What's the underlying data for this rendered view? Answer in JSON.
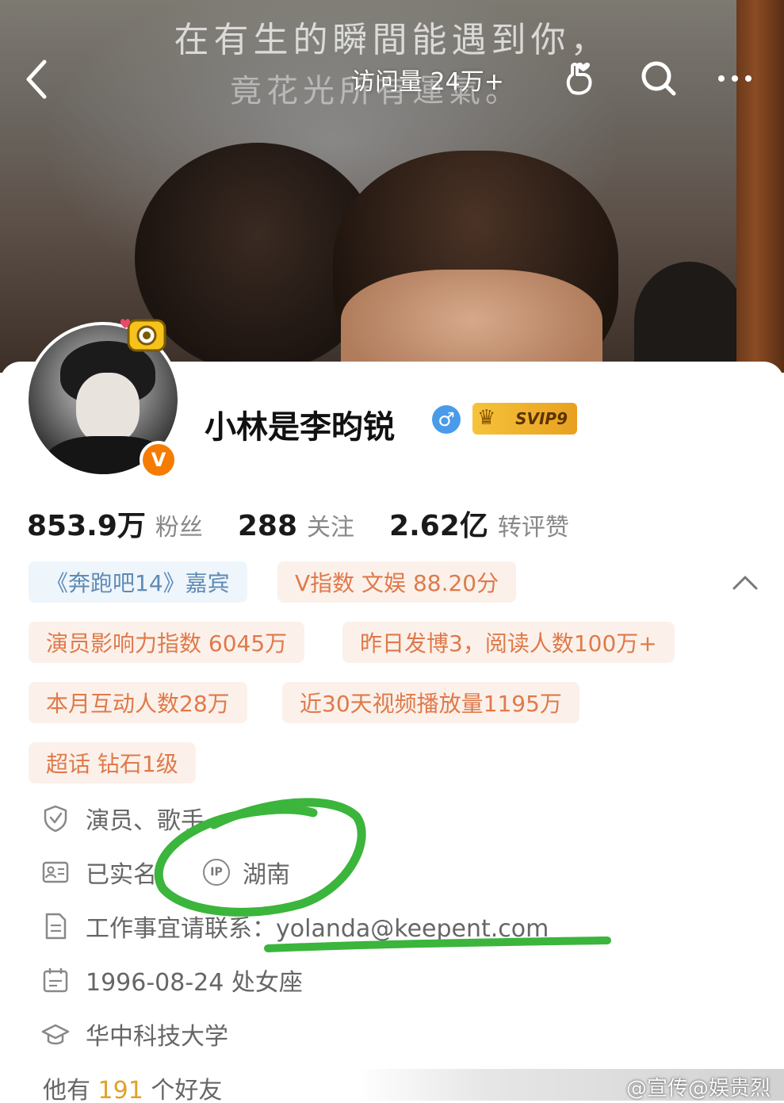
{
  "cover": {
    "caption_line1": "在有生的瞬間能遇到你，",
    "caption_line2": "竟花光所有運氣。"
  },
  "topbar": {
    "back_icon": "chevron-left-icon",
    "visits": "访问量 24万+",
    "icons": [
      "hand-heart-icon",
      "search-icon",
      "more-icon"
    ]
  },
  "profile": {
    "username": "小林是李昀锐",
    "gender_symbol": "♂",
    "svip_label": "SVIP9",
    "verified_symbol": "V"
  },
  "stats": [
    {
      "value": "853.9万",
      "label": "粉丝"
    },
    {
      "value": "288",
      "label": "关注"
    },
    {
      "value": "2.62亿",
      "label": "转评赞"
    }
  ],
  "tags": [
    "《奔跑吧14》嘉宾",
    "V指数 文娱 88.20分",
    "演员影响力指数 6045万",
    "昨日发博3，阅读人数100万+",
    "本月互动人数28万",
    "近30天视频播放量1195万",
    "超话 钻石1级"
  ],
  "info": {
    "occupation": "演员、歌手",
    "realname": "已实名",
    "ip_label": "IP",
    "ip_location": "湖南",
    "contact": "工作事宜请联系：yolanda@keepent.com",
    "birthday": "1996-08-24 处女座",
    "school": "华中科技大学"
  },
  "friends": {
    "prefix": "他有",
    "count": "191",
    "suffix": "个好友"
  },
  "watermark": "@宣传@娱贵烈",
  "colors": {
    "tag_orange_bg": "#fbf1ea",
    "tag_orange_text": "#e0794a",
    "tag_blue_bg": "#eef5fb",
    "tag_blue_text": "#5f8bb4",
    "verified_orange": "#f57c00",
    "gender_blue": "#4a9bea",
    "scribble_green": "#3bb53b"
  }
}
